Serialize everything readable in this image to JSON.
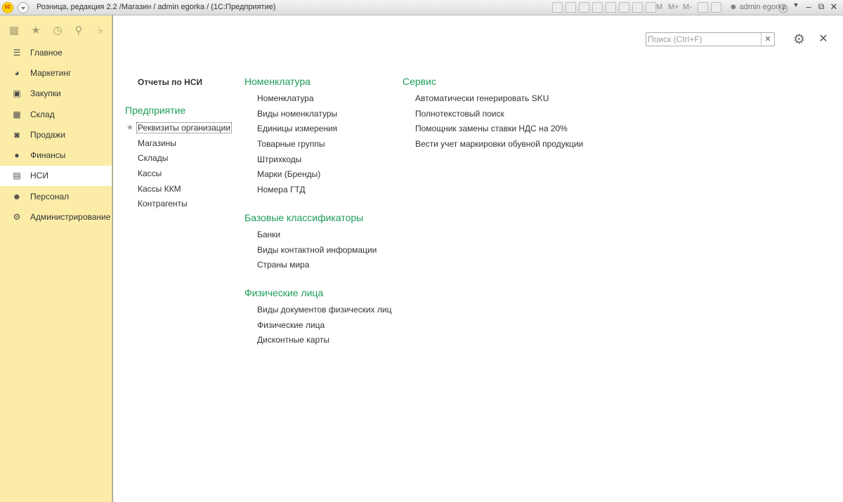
{
  "titlebar": {
    "logo": "1С",
    "title": "Розница, редакция 2.2 /Магазин / admin egorka /  (1С:Предприятие)",
    "m_labels": [
      "M",
      "M+",
      "M-"
    ],
    "user": "admin egorka"
  },
  "sidebar": {
    "top_icons": [
      "apps-grid-icon",
      "star-icon",
      "history-icon",
      "search-icon",
      "bell-icon"
    ],
    "items": [
      {
        "label": "Главное",
        "icon": "menu-lines-icon"
      },
      {
        "label": "Маркетинг",
        "icon": "pie-chart-icon"
      },
      {
        "label": "Закупки",
        "icon": "cart-icon"
      },
      {
        "label": "Склад",
        "icon": "warehouse-icon"
      },
      {
        "label": "Продажи",
        "icon": "basket-icon"
      },
      {
        "label": "Финансы",
        "icon": "coin-icon"
      },
      {
        "label": "НСИ",
        "icon": "books-icon",
        "active": true
      },
      {
        "label": "Персонал",
        "icon": "person-icon"
      },
      {
        "label": "Администрирование",
        "icon": "gear-icon"
      }
    ]
  },
  "search": {
    "placeholder": "Поиск (Ctrl+F)",
    "value": ""
  },
  "col1": {
    "reports": "Отчеты по НСИ",
    "group": "Предприятие",
    "links": [
      "Реквизиты организации",
      "Магазины",
      "Склады",
      "Кассы",
      "Кассы ККМ",
      "Контрагенты"
    ]
  },
  "col2": {
    "groups": [
      {
        "title": "Номенклатура",
        "links": [
          "Номенклатура",
          "Виды номенклатуры",
          "Единицы измерения",
          "Товарные группы",
          "Штрихкоды",
          "Марки (Бренды)",
          "Номера ГТД"
        ]
      },
      {
        "title": "Базовые классификаторы",
        "links": [
          "Банки",
          "Виды контактной информации",
          "Страны мира"
        ]
      },
      {
        "title": "Физические лица",
        "links": [
          "Виды документов физических лиц",
          "Физические лица",
          "Дисконтные карты"
        ]
      }
    ]
  },
  "col3": {
    "group": "Сервис",
    "links": [
      "Автоматически генерировать SKU",
      "Полнотекстовый поиск",
      "Помощник замены ставки НДС на 20%",
      "Вести учет маркировки обувной продукции"
    ]
  },
  "colors": {
    "sidebar_bg": "#fbeda8",
    "group_title": "#1d9c59",
    "active_item_bg": "#ffffff"
  }
}
